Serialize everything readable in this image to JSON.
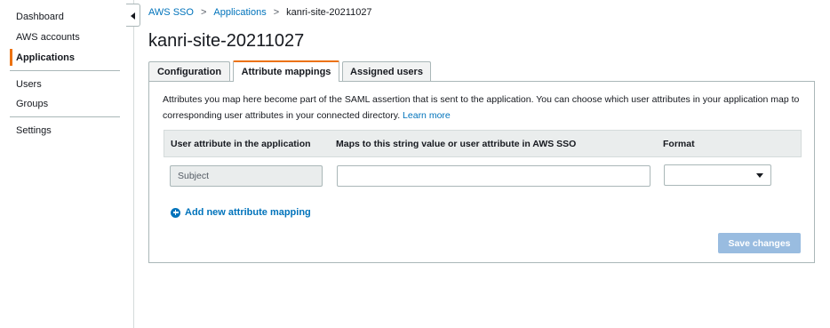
{
  "sidebar": {
    "items": [
      {
        "label": "Dashboard"
      },
      {
        "label": "AWS accounts"
      },
      {
        "label": "Applications"
      },
      {
        "label": "Users"
      },
      {
        "label": "Groups"
      },
      {
        "label": "Settings"
      }
    ],
    "active_accent": "#ec7211"
  },
  "breadcrumb": {
    "items": [
      "AWS SSO",
      "Applications"
    ],
    "current": "kanri-site-20211027",
    "separator": ">"
  },
  "page": {
    "title": "kanri-site-20211027"
  },
  "tabs": [
    {
      "label": "Configuration"
    },
    {
      "label": "Attribute mappings"
    },
    {
      "label": "Assigned users"
    }
  ],
  "panel": {
    "description": "Attributes you map here become part of the SAML assertion that is sent to the application. You can choose which user attributes in your application map to corresponding user attributes in your connected directory.",
    "learn_more": "Learn more",
    "columns": [
      "User attribute in the application",
      "Maps to this string value or user attribute in AWS SSO",
      "Format"
    ],
    "rows": [
      {
        "attribute": "Subject",
        "maps_to": "",
        "format": ""
      }
    ],
    "add_mapping_label": "Add new attribute mapping",
    "save_label": "Save changes"
  },
  "colors": {
    "link": "#0073bb",
    "accent": "#ec7211",
    "save_disabled": "#99bce0"
  }
}
